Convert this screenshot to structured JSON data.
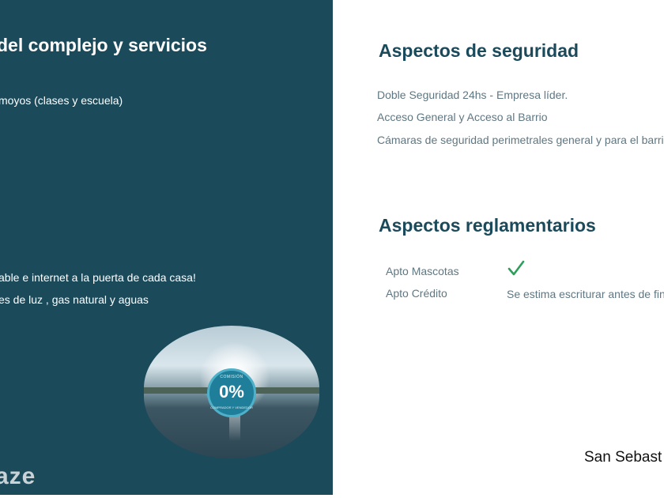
{
  "left": {
    "title": "del complejo y servicios",
    "lines": [
      "moyos  (clases y escuela)",
      "able e internet a la puerta de cada casa!",
      "es de luz , gas natural y aguas"
    ],
    "photo_badge": {
      "top": "COMISIÓN",
      "value": "0%",
      "bottom": "COMPRADOR Y VENDEDOR"
    },
    "logo": "aze"
  },
  "security": {
    "title": "Aspectos de seguridad",
    "items": [
      "Doble Seguridad   24hs  -  Empresa líder.",
      "Acceso General y Acceso al Barrio",
      "Cámaras de seguridad perimetrales general y para el barrio"
    ]
  },
  "regulatory": {
    "title": "Aspectos reglamentarios",
    "rows": [
      {
        "label": "Apto Mascotas",
        "icon": "checkmark-icon"
      },
      {
        "label": "Apto Crédito",
        "value": "Se estima escriturar antes de fin"
      }
    ],
    "check_color": "#2e9e5b"
  },
  "footer": {
    "place": "San Sebast"
  },
  "colors": {
    "panel": "#1b4a5b",
    "heading": "#1b4a5b",
    "body_text": "#5f7782"
  }
}
